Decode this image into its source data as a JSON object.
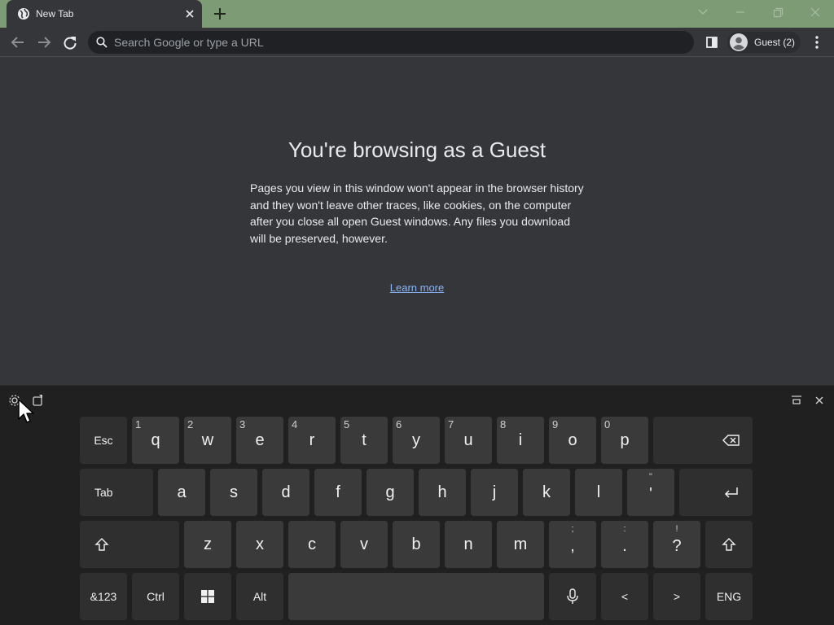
{
  "browser": {
    "tab_title": "New Tab",
    "omnibox_placeholder": "Search Google or type a URL",
    "profile_label": "Guest (2)",
    "titlebar_color": "#7d9c75"
  },
  "page": {
    "title": "You're browsing as a Guest",
    "description": "Pages you view in this window won't appear in the browser history and they won't leave other traces, like cookies, on the computer after you close all open Guest windows. Any files you download will be preserved, however.",
    "learn_more": "Learn more",
    "link_color": "#8ab4f8"
  },
  "keyboard": {
    "row1": {
      "esc": "Esc",
      "keys": [
        {
          "hint": "1",
          "label": "q"
        },
        {
          "hint": "2",
          "label": "w"
        },
        {
          "hint": "3",
          "label": "e"
        },
        {
          "hint": "4",
          "label": "r"
        },
        {
          "hint": "5",
          "label": "t"
        },
        {
          "hint": "6",
          "label": "y"
        },
        {
          "hint": "7",
          "label": "u"
        },
        {
          "hint": "8",
          "label": "i"
        },
        {
          "hint": "9",
          "label": "o"
        },
        {
          "hint": "0",
          "label": "p"
        }
      ],
      "backspace_icon": "backspace-icon"
    },
    "row2": {
      "tab": "Tab",
      "keys": [
        "a",
        "s",
        "d",
        "f",
        "g",
        "h",
        "j",
        "k",
        "l"
      ],
      "quote": {
        "sub": "\"",
        "label": "'"
      },
      "enter_icon": "enter-icon"
    },
    "row3": {
      "shift_icon": "shift-icon",
      "keys": [
        "z",
        "x",
        "c",
        "v",
        "b",
        "n",
        "m"
      ],
      "comma": {
        "sub": ";",
        "label": ","
      },
      "period": {
        "sub": ":",
        "label": "."
      },
      "question": {
        "sub": "!",
        "label": "?"
      }
    },
    "row4": {
      "numbers": "&123",
      "ctrl": "Ctrl",
      "alt": "Alt",
      "windows_icon": "windows-icon",
      "mic_icon": "microphone-icon",
      "left": "<",
      "right": ">",
      "language": "ENG"
    }
  }
}
